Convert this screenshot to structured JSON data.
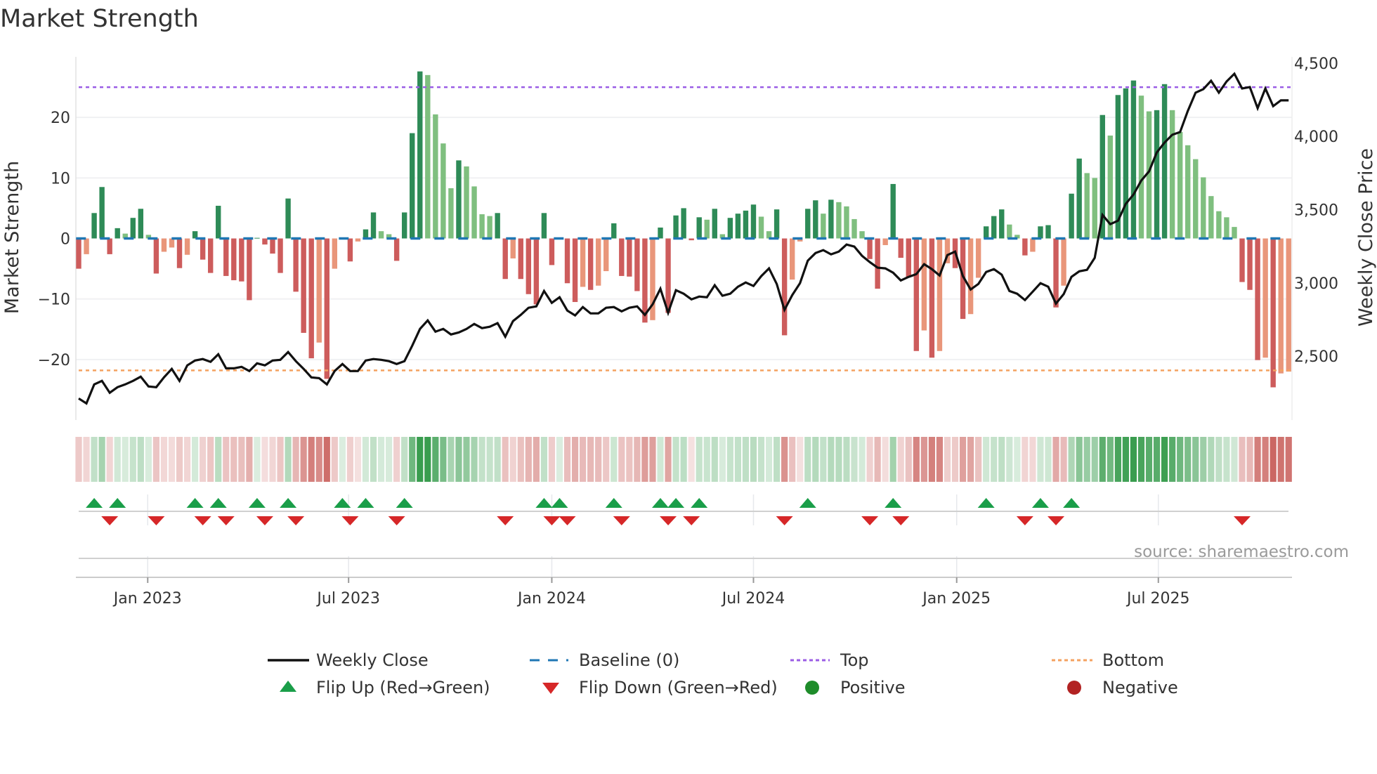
{
  "colors": {
    "pos_up": "#2e8b57",
    "pos_down": "#7fbf7f",
    "neg_down": "#cd5c5c",
    "neg_up": "#e9967a",
    "baseline": "#1f77b4",
    "top": "#9b5de5",
    "bottom": "#f4a261",
    "close": "#111111",
    "flip_up": "#1a9e49",
    "flip_down": "#d62728",
    "positive": "#1e8c2a",
    "negative": "#b22222",
    "heat_pos": "#3a9d4f",
    "heat_neg": "#c9605c"
  },
  "chart_data": {
    "type": "bar",
    "title": "Market Strength",
    "ylabel": "Market Strength",
    "y2label": "Weekly Close Price",
    "ylim": [
      -30,
      30
    ],
    "y2lim": [
      2064,
      4543
    ],
    "yticks": [
      {
        "v": 20,
        "label": "20"
      },
      {
        "v": 10,
        "label": "10"
      },
      {
        "v": 0,
        "label": "0"
      },
      {
        "v": -10,
        "label": "−10"
      },
      {
        "v": -20,
        "label": "−20"
      }
    ],
    "y2ticks": [
      {
        "v": 4500,
        "label": "4,500"
      },
      {
        "v": 4000,
        "label": "4,000"
      },
      {
        "v": 3500,
        "label": "3,500"
      },
      {
        "v": 3000,
        "label": "3,000"
      },
      {
        "v": 2500,
        "label": "2,500"
      }
    ],
    "xticks": [
      {
        "week": 8.9,
        "label": "Jan 2023"
      },
      {
        "week": 34.8,
        "label": "Jul 2023"
      },
      {
        "week": 61.0,
        "label": "Jan 2024"
      },
      {
        "week": 87.0,
        "label": "Jul 2024"
      },
      {
        "week": 113.2,
        "label": "Jan 2025"
      },
      {
        "week": 139.2,
        "label": "Jul 2025"
      }
    ],
    "top_level": 25.0,
    "bottom_level": -21.8,
    "baseline": 0,
    "grid": true,
    "legend_placement": "bottom",
    "strength": [
      -5.0,
      -2.6,
      4.2,
      8.5,
      -2.6,
      1.7,
      0.8,
      3.4,
      4.9,
      0.6,
      -5.8,
      -2.2,
      -1.5,
      -4.9,
      -2.7,
      1.2,
      -3.5,
      -5.7,
      5.4,
      -6.2,
      -6.9,
      -7.1,
      -10.2,
      0.1,
      -1.0,
      -2.5,
      -5.7,
      6.6,
      -8.8,
      -15.6,
      -19.8,
      -17.2,
      -23.2,
      -5.0,
      0.1,
      -3.8,
      -0.5,
      1.5,
      4.3,
      1.2,
      0.7,
      -3.7,
      4.3,
      17.4,
      27.6,
      27.0,
      20.5,
      15.7,
      8.3,
      12.9,
      11.9,
      8.6,
      4.0,
      3.7,
      4.2,
      -6.7,
      -3.3,
      -6.7,
      -9.2,
      -10.9,
      4.2,
      -4.4,
      0.1,
      -7.4,
      -10.5,
      -8.0,
      -8.5,
      -7.8,
      -5.4,
      2.5,
      -6.2,
      -6.3,
      -8.7,
      -13.9,
      -13.5,
      1.8,
      -12.3,
      3.8,
      5.0,
      -0.3,
      3.5,
      3.1,
      4.9,
      0.7,
      3.4,
      4.1,
      4.6,
      5.6,
      3.6,
      1.2,
      4.8,
      -16.0,
      -6.8,
      -0.5,
      4.9,
      6.3,
      4.1,
      6.4,
      6.0,
      5.3,
      3.2,
      1.2,
      -3.4,
      -8.3,
      -1.1,
      9.0,
      -3.2,
      -6.4,
      -18.6,
      -15.2,
      -19.7,
      -18.6,
      -4.1,
      -4.9,
      -13.3,
      -12.5,
      -6.5,
      2.0,
      3.7,
      4.8,
      2.3,
      0.6,
      -2.8,
      -2.2,
      2.0,
      2.2,
      -11.4,
      -7.8,
      7.4,
      13.2,
      10.8,
      10.0,
      20.4,
      17.0,
      23.7,
      24.8,
      26.1,
      23.6,
      21.0,
      21.2,
      25.5,
      21.2,
      17.6,
      15.4,
      13.1,
      10.1,
      7.0,
      4.5,
      3.5,
      1.9,
      -7.2,
      -8.5,
      -20.1,
      -19.7,
      -24.6,
      -22.3,
      -22.0
    ],
    "weekly_close": [
      2211,
      2177,
      2307,
      2331,
      2250,
      2288,
      2307,
      2331,
      2360,
      2293,
      2288,
      2355,
      2413,
      2331,
      2437,
      2470,
      2480,
      2461,
      2513,
      2417,
      2417,
      2427,
      2398,
      2451,
      2437,
      2470,
      2475,
      2528,
      2466,
      2413,
      2355,
      2350,
      2307,
      2398,
      2446,
      2398,
      2398,
      2470,
      2480,
      2475,
      2466,
      2446,
      2466,
      2571,
      2686,
      2744,
      2667,
      2686,
      2648,
      2662,
      2686,
      2720,
      2691,
      2701,
      2725,
      2633,
      2739,
      2782,
      2830,
      2840,
      2945,
      2864,
      2902,
      2811,
      2778,
      2835,
      2792,
      2792,
      2830,
      2835,
      2806,
      2830,
      2840,
      2782,
      2854,
      2960,
      2796,
      2950,
      2926,
      2888,
      2907,
      2902,
      2984,
      2912,
      2926,
      2974,
      3003,
      2979,
      3046,
      3099,
      2993,
      2816,
      2917,
      2998,
      3152,
      3204,
      3224,
      3195,
      3214,
      3262,
      3248,
      3185,
      3142,
      3104,
      3099,
      3070,
      3017,
      3041,
      3060,
      3128,
      3094,
      3051,
      3190,
      3214,
      3046,
      2955,
      2993,
      3075,
      3094,
      3056,
      2945,
      2926,
      2883,
      2940,
      2998,
      2974,
      2859,
      2924,
      3041,
      3079,
      3089,
      3171,
      3464,
      3401,
      3425,
      3540,
      3603,
      3699,
      3761,
      3891,
      3958,
      4011,
      4030,
      4174,
      4299,
      4323,
      4380,
      4299,
      4375,
      4428,
      4327,
      4337,
      4193,
      4327,
      4207,
      4246,
      4246
    ]
  },
  "legend": {
    "weekly_close": "Weekly Close",
    "baseline": "Baseline (0)",
    "top": "Top",
    "bottom": "Bottom",
    "flip_up": "Flip Up (Red→Green)",
    "flip_down": "Flip Down (Green→Red)",
    "positive": "Positive",
    "negative": "Negative"
  },
  "source": "source: sharemaestro.com"
}
